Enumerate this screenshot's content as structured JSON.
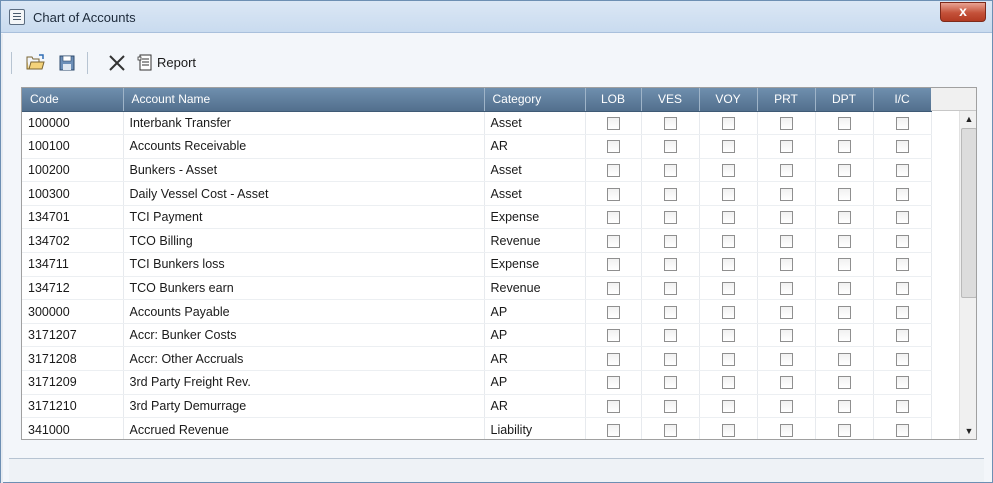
{
  "window": {
    "title": "Chart of Accounts",
    "close_label": "x"
  },
  "toolbar": {
    "report_label": "Report"
  },
  "grid": {
    "columns": [
      "Code",
      "Account Name",
      "Category",
      "LOB",
      "VES",
      "VOY",
      "PRT",
      "DPT",
      "I/C"
    ],
    "rows": [
      {
        "code": "100000",
        "name": "Interbank Transfer",
        "category": "Asset"
      },
      {
        "code": "100100",
        "name": "Accounts Receivable",
        "category": "AR"
      },
      {
        "code": "100200",
        "name": "Bunkers - Asset",
        "category": "Asset"
      },
      {
        "code": "100300",
        "name": "Daily Vessel Cost - Asset",
        "category": "Asset"
      },
      {
        "code": "134701",
        "name": "TCI Payment",
        "category": "Expense"
      },
      {
        "code": "134702",
        "name": "TCO Billing",
        "category": "Revenue"
      },
      {
        "code": "134711",
        "name": "TCI Bunkers loss",
        "category": "Expense"
      },
      {
        "code": "134712",
        "name": "TCO Bunkers earn",
        "category": "Revenue"
      },
      {
        "code": "300000",
        "name": "Accounts Payable",
        "category": "AP"
      },
      {
        "code": "3171207",
        "name": "Accr: Bunker Costs",
        "category": "AP"
      },
      {
        "code": "3171208",
        "name": "Accr: Other Accruals",
        "category": "AR"
      },
      {
        "code": "3171209",
        "name": "3rd Party Freight Rev.",
        "category": "AP"
      },
      {
        "code": "3171210",
        "name": "3rd Party Demurrage",
        "category": "AR"
      },
      {
        "code": "341000",
        "name": "Accrued Revenue",
        "category": "Liability"
      }
    ]
  },
  "colors": {
    "header_bg": "#5f7f9e",
    "close_red": "#c4523a"
  }
}
